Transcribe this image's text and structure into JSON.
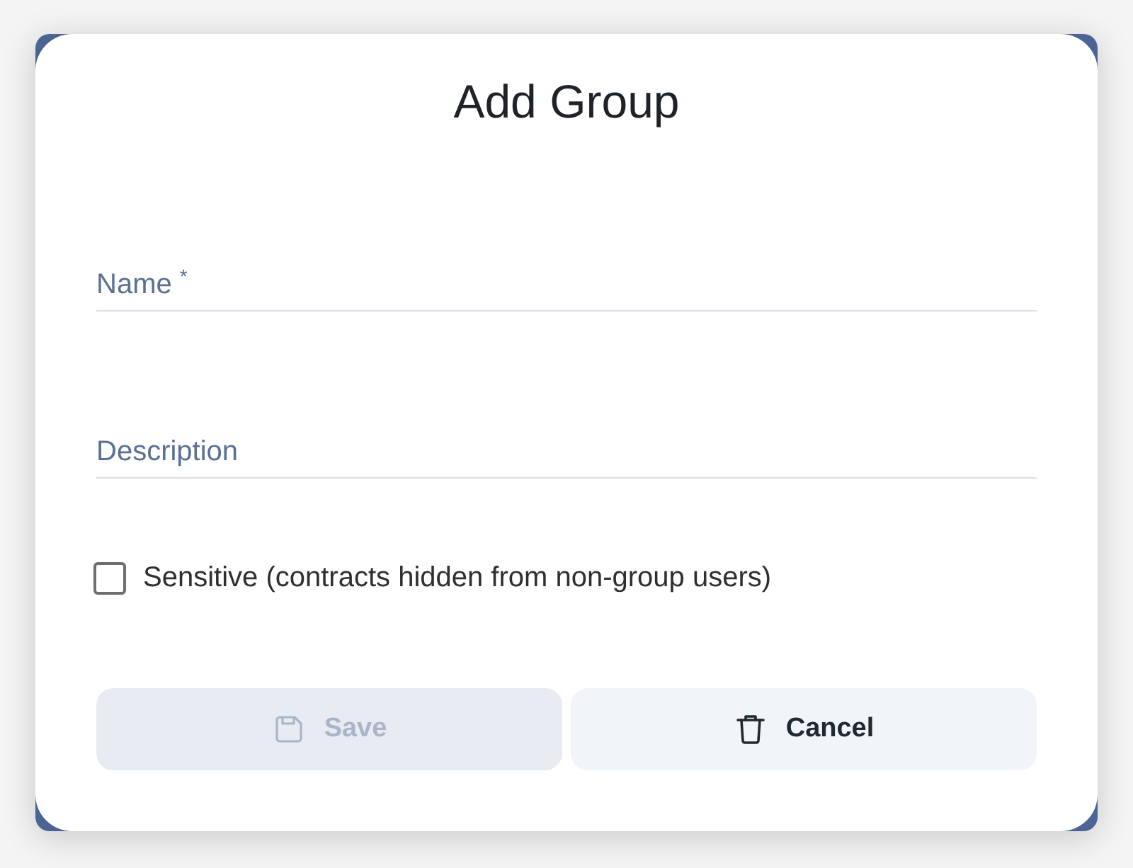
{
  "dialog": {
    "title": "Add Group"
  },
  "fields": [
    {
      "placeholder": "Name $^{*}$"
    },
    {
      "placeholder": "Description"
    }
  ],
  "checkbox": {
    "label": "Sensitive (contracts hidden from non-group users)",
    "checked": false
  },
  "buttons": [
    {
      "kind": "save",
      "label": "Save",
      "disabled": true
    },
    {
      "kind": "cancel",
      "label": "Cancel",
      "disabled": false
    }
  ]
}
